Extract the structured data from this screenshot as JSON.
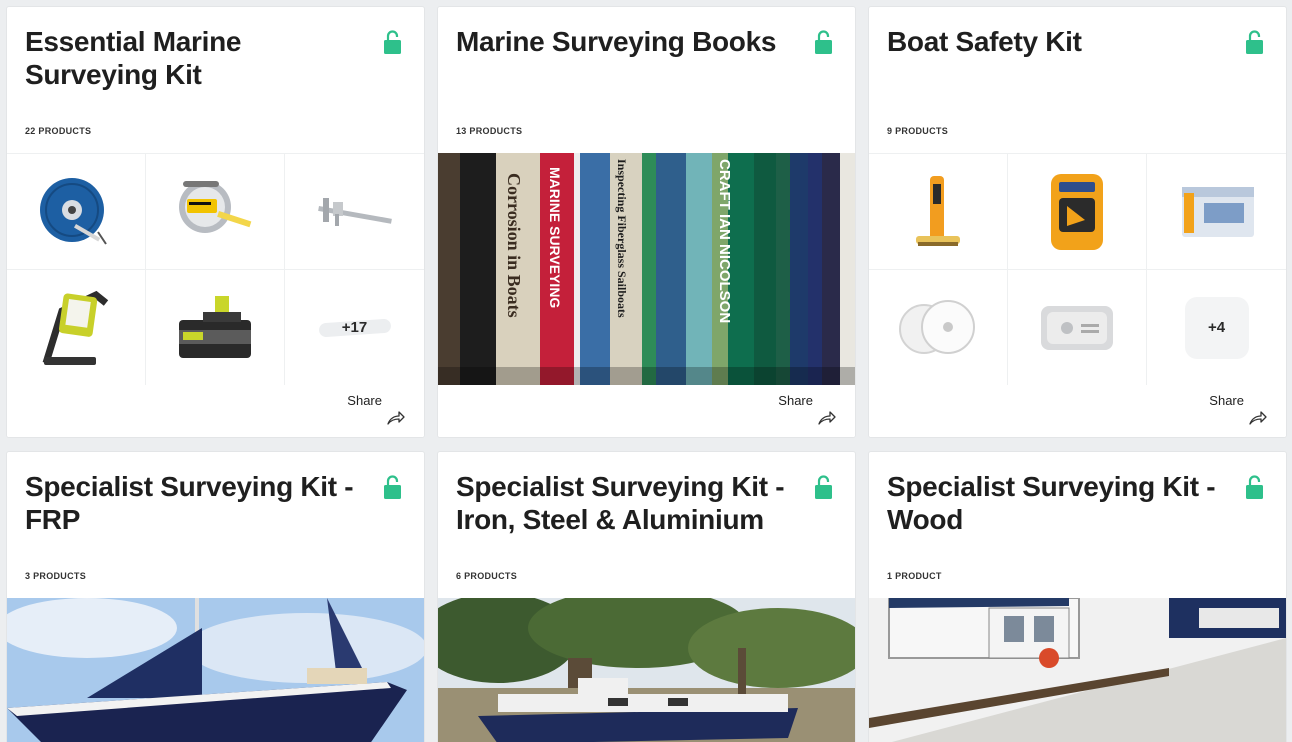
{
  "colors": {
    "accent": "#2ec08b",
    "background": "#eceef0",
    "card": "#ffffff"
  },
  "cards": [
    {
      "title": "Essential Marine Surveying Kit",
      "count": "22 PRODUCTS",
      "share": "Share",
      "more": "+17",
      "lock": "unlocked-lock-icon"
    },
    {
      "title": "Marine Surveying Books",
      "count": "13 PRODUCTS",
      "share": "Share",
      "lock": "unlocked-lock-icon"
    },
    {
      "title": "Boat Safety Kit",
      "count": "9 PRODUCTS",
      "share": "Share",
      "more": "+4",
      "lock": "unlocked-lock-icon"
    },
    {
      "title": "Specialist Surveying Kit - FRP",
      "count": "3 PRODUCTS",
      "lock": "unlocked-lock-icon"
    },
    {
      "title": "Specialist Surveying Kit - Iron, Steel & Aluminium",
      "count": "6 PRODUCTS",
      "lock": "unlocked-lock-icon"
    },
    {
      "title": "Specialist Surveying Kit - Wood",
      "count": "1 PRODUCT",
      "lock": "unlocked-lock-icon"
    }
  ]
}
